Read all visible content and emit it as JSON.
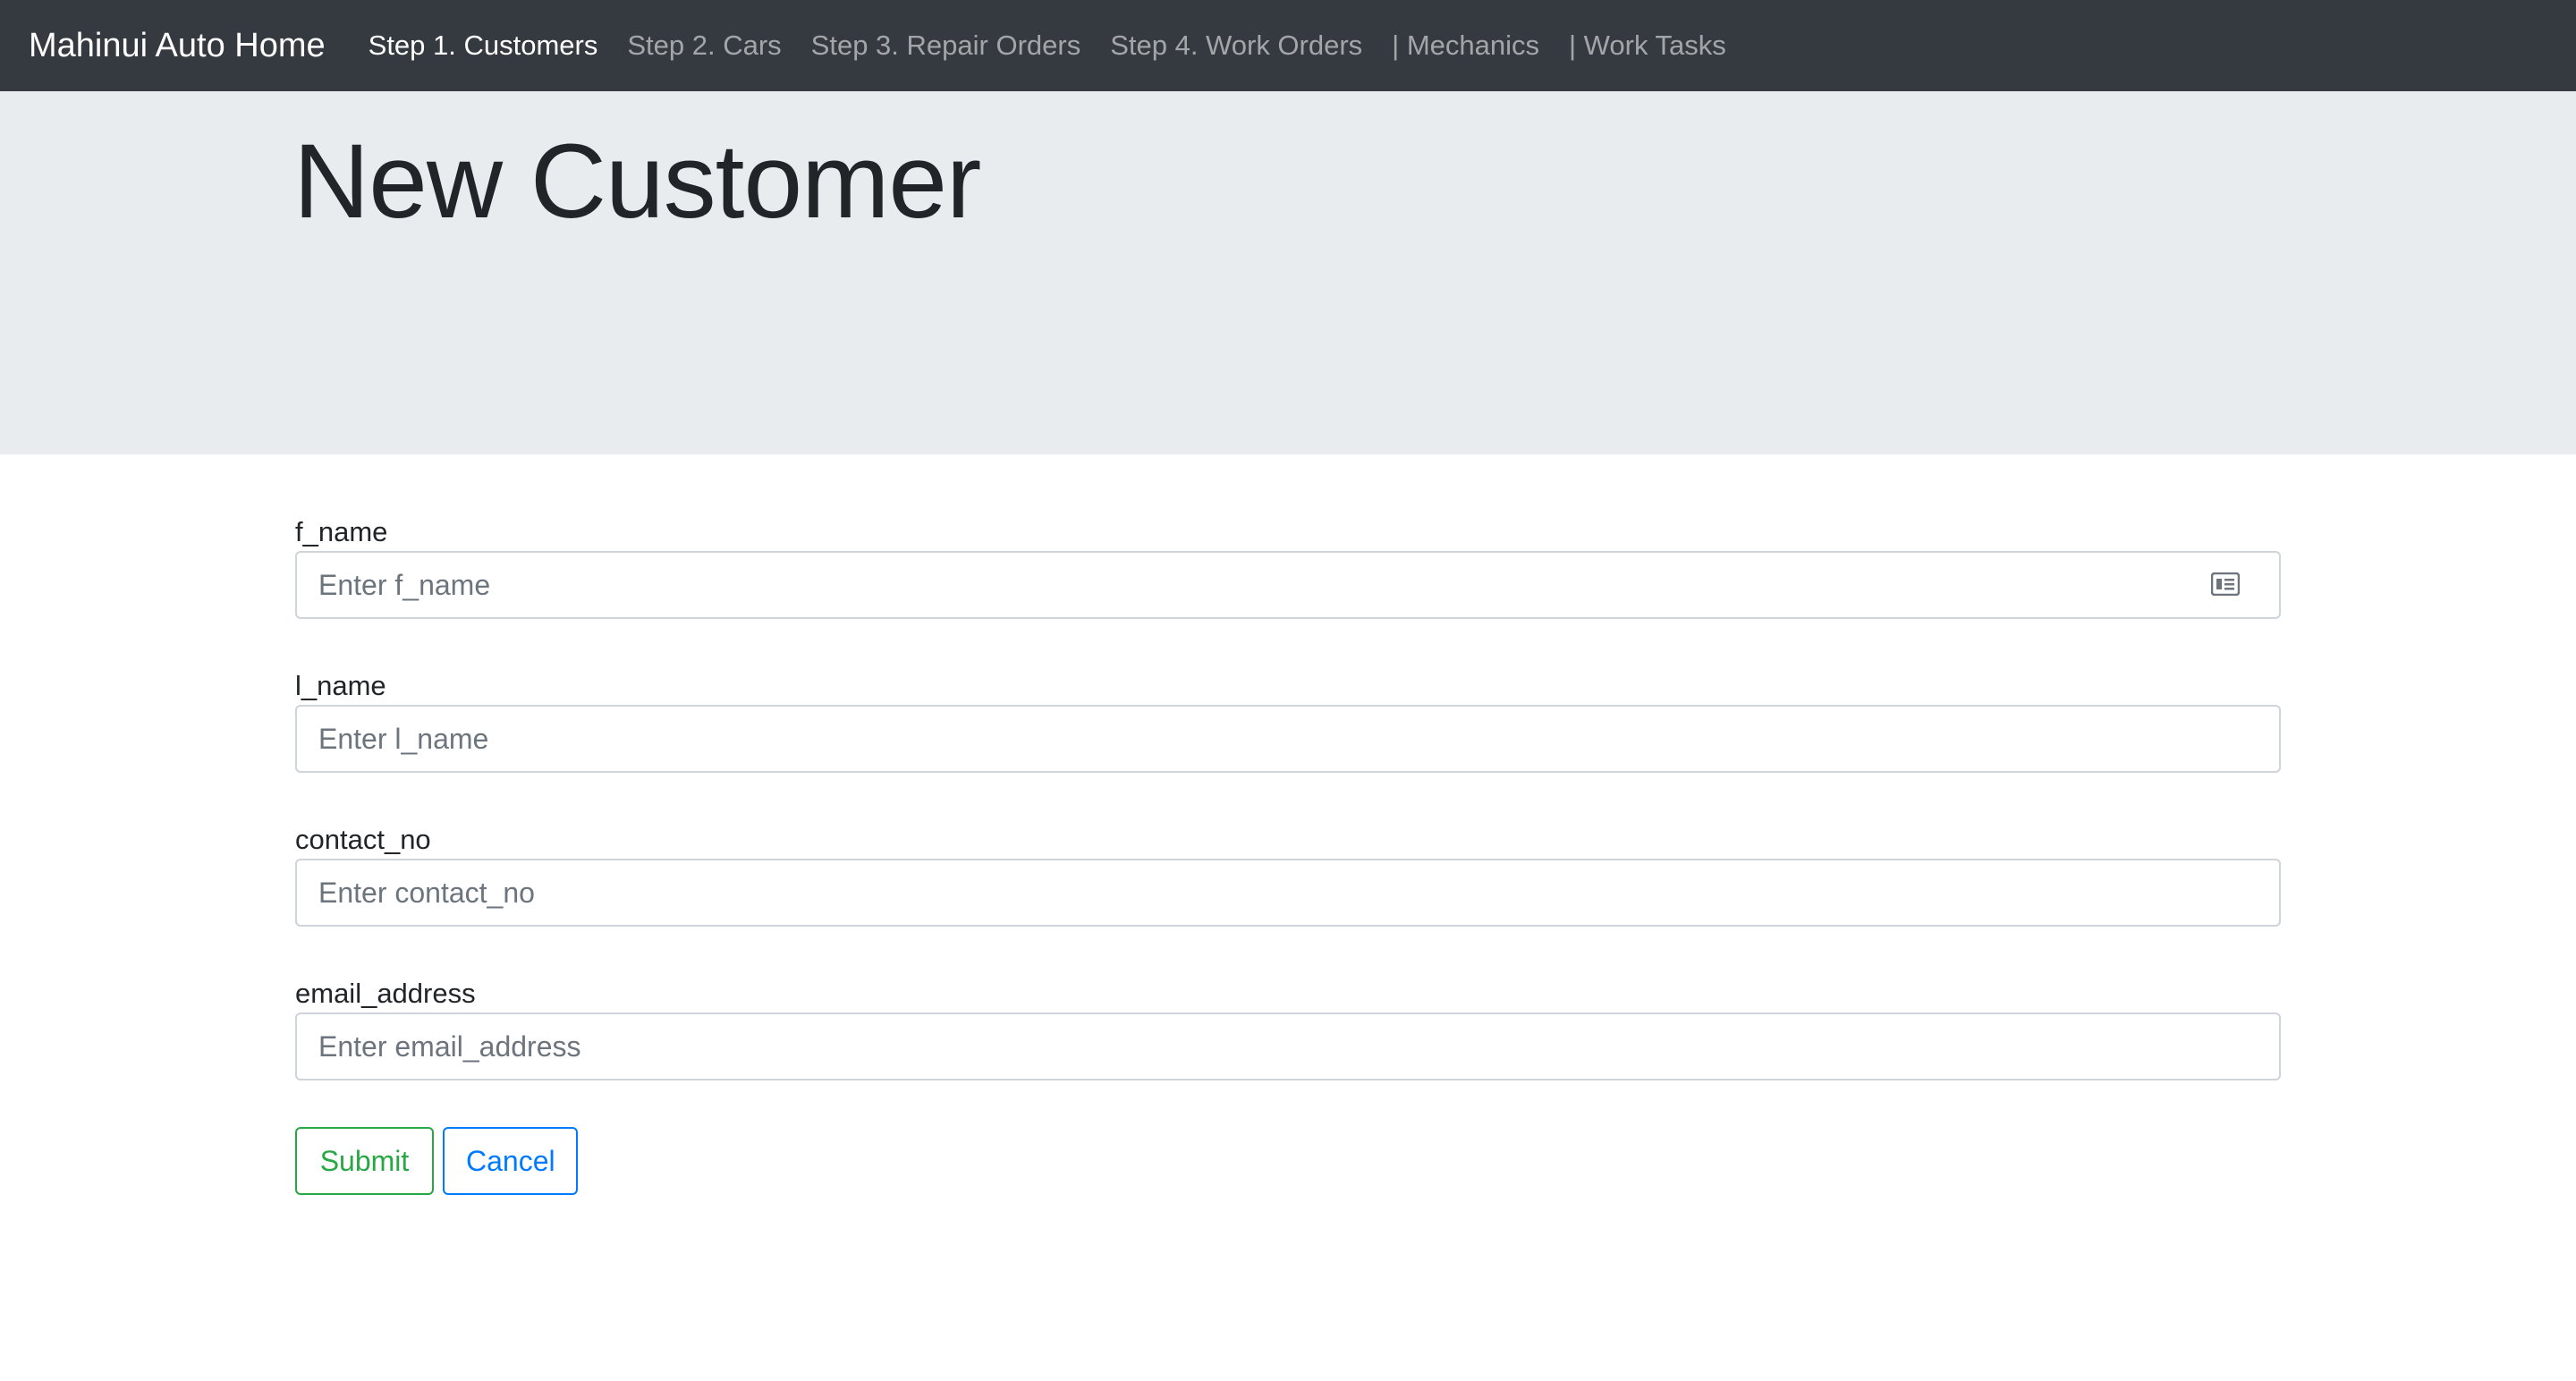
{
  "navbar": {
    "brand": "Mahinui Auto Home",
    "items": [
      {
        "label": "Step 1. Customers",
        "active": true
      },
      {
        "label": "Step 2. Cars",
        "active": false
      },
      {
        "label": "Step 3. Repair Orders",
        "active": false
      },
      {
        "label": "Step 4. Work Orders",
        "active": false
      },
      {
        "label": "| Mechanics",
        "active": false
      },
      {
        "label": "| Work Tasks",
        "active": false
      }
    ]
  },
  "page": {
    "title": "New Customer"
  },
  "form": {
    "fields": [
      {
        "label": "f_name",
        "placeholder": "Enter f_name",
        "value": ""
      },
      {
        "label": "l_name",
        "placeholder": "Enter l_name",
        "value": ""
      },
      {
        "label": "contact_no",
        "placeholder": "Enter contact_no",
        "value": ""
      },
      {
        "label": "email_address",
        "placeholder": "Enter email_address",
        "value": ""
      }
    ],
    "submit_label": "Submit",
    "cancel_label": "Cancel"
  },
  "colors": {
    "navbar_bg": "#343a40",
    "jumbotron_bg": "#e9ecef",
    "submit": "#28a745",
    "cancel": "#007bff"
  },
  "icons": {
    "f_name_field_icon": "contact-card-icon"
  }
}
